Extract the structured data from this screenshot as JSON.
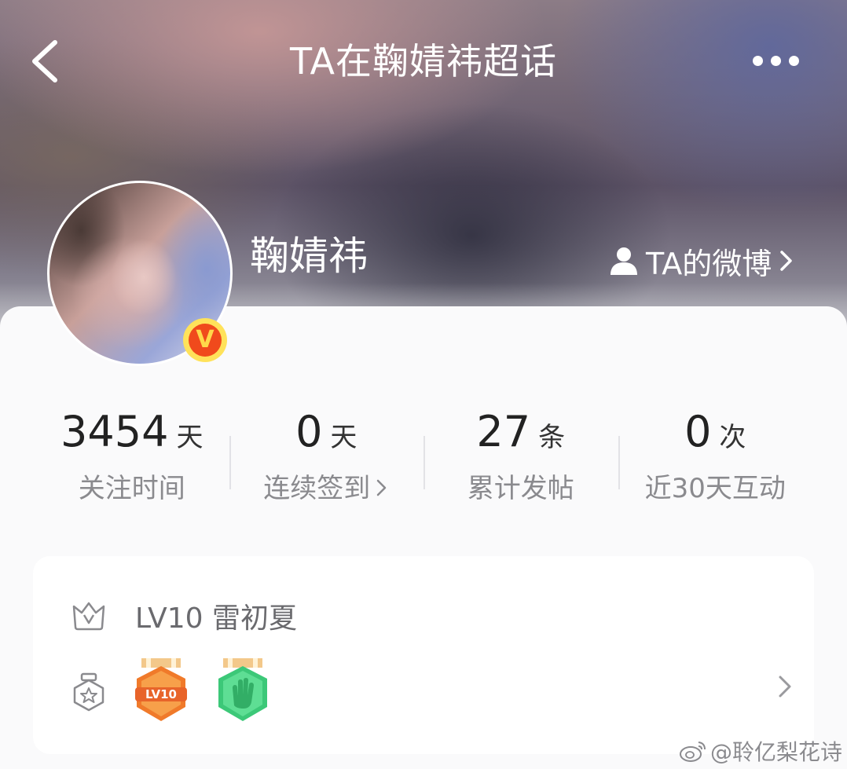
{
  "header": {
    "title": "TA在鞠婧祎超话",
    "back_icon": "chevron-left-icon",
    "more_icon": "more-dots-icon"
  },
  "profile": {
    "name": "鞠婧祎",
    "verified_badge": "V",
    "weibo_link_label": "TA的微博"
  },
  "stats": [
    {
      "value": "3454",
      "unit": "天",
      "label": "关注时间",
      "has_chevron": false
    },
    {
      "value": "0",
      "unit": "天",
      "label": "连续签到",
      "has_chevron": true
    },
    {
      "value": "27",
      "unit": "条",
      "label": "累计发帖",
      "has_chevron": false
    },
    {
      "value": "0",
      "unit": "次",
      "label": "近30天互动",
      "has_chevron": false
    }
  ],
  "level": {
    "text": "LV10 雷初夏",
    "icon": "crown-v-icon"
  },
  "badges": {
    "icon": "medal-star-icon",
    "items": [
      {
        "name": "lv10-medal",
        "text": "LV10",
        "color": "#f07a2a"
      },
      {
        "name": "wave-hand-medal",
        "text": "",
        "color": "#3cc878"
      }
    ]
  },
  "watermark": "@聆亿梨花诗",
  "colors": {
    "verified_badge": "#f04a1c",
    "verified_ring": "#ffe25a"
  }
}
